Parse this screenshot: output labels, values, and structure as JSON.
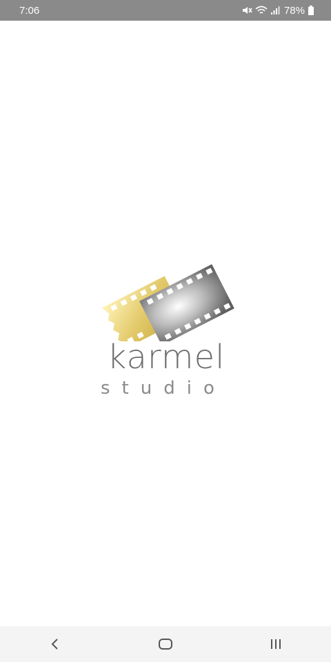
{
  "status_bar": {
    "time": "7:06",
    "battery": "78%",
    "icons": [
      "mute-icon",
      "wifi-icon",
      "signal-icon",
      "battery-icon"
    ]
  },
  "splash": {
    "brand": "karmel",
    "subtitle": "studio",
    "logo_icon": "film-strip-logo",
    "colors": {
      "gold": "#e6d27a",
      "silver": "#8c8c8c",
      "text": "#6e6e6e"
    }
  },
  "nav_bar": {
    "back_icon": "back-icon",
    "home_icon": "home-icon",
    "recents_icon": "recents-icon"
  }
}
